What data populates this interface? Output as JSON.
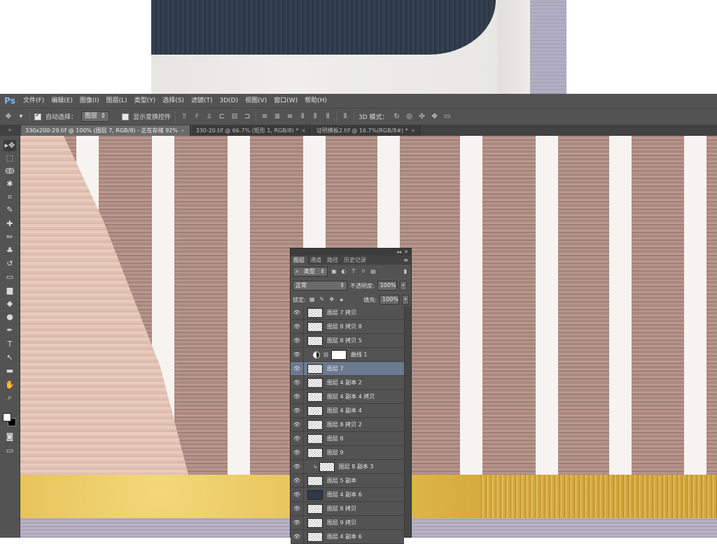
{
  "app": {
    "logo": "Ps"
  },
  "menu": [
    "文件(F)",
    "编辑(E)",
    "图像(I)",
    "图层(L)",
    "类型(Y)",
    "选择(S)",
    "滤镜(T)",
    "3D(D)",
    "视图(V)",
    "窗口(W)",
    "帮助(H)"
  ],
  "options": {
    "move_tool_icon": "move-tool-icon",
    "auto_select_label": "自动选择：",
    "auto_select_value": "图层",
    "show_transform_label": "显示变换控件",
    "mode_label": "3D 模式："
  },
  "tabs": [
    {
      "label": "330x200-29.tif @ 100% (图层 7, RGB/8) - 正在存储 92%",
      "active": true
    },
    {
      "label": "330-20.tif @ 66.7% (矩形 1, RGB/8) *",
      "active": false
    },
    {
      "label": "证明模板2.tif @ 16.7%(RGB/8#) *",
      "active": false
    }
  ],
  "tabs_collapse": "»",
  "tools": [
    "move-icon",
    "marquee-icon",
    "lasso-icon",
    "quick-select-icon",
    "crop-icon",
    "eyedropper-icon",
    "spot-heal-icon",
    "brush-icon",
    "stamp-icon",
    "history-brush-icon",
    "eraser-icon",
    "gradient-icon",
    "blur-icon",
    "dodge-icon",
    "pen-icon",
    "type-icon",
    "path-select-icon",
    "shape-icon",
    "hand-icon",
    "zoom-icon"
  ],
  "tool_glyphs": [
    "▸✥",
    "⬚",
    "ↂ",
    "✱",
    "⌗",
    "✎",
    "✚",
    "✏",
    "♣",
    "↺",
    "▭",
    "▆",
    "◆",
    "●",
    "✒",
    "T",
    "↖",
    "▬",
    "✋",
    "⌕"
  ],
  "layers_panel": {
    "tabs": [
      "图层",
      "通道",
      "路径",
      "历史记录"
    ],
    "filter_label": "类型",
    "blend_mode": "正常",
    "opacity_label": "不透明度:",
    "opacity_value": "100%",
    "lock_label": "锁定:",
    "fill_label": "填充:",
    "fill_value": "100%",
    "layers": [
      {
        "name": "图层 7 拷贝",
        "thumb": "checker"
      },
      {
        "name": "图层 8 拷贝 8",
        "thumb": "checker"
      },
      {
        "name": "图层 8 拷贝 5",
        "thumb": "checker"
      },
      {
        "name": "曲线 1",
        "thumb": "adjust"
      },
      {
        "name": "图层 7",
        "thumb": "checker",
        "selected": true
      },
      {
        "name": "图层 4 副本 2",
        "thumb": "checker"
      },
      {
        "name": "图层 4 副本 4 拷贝",
        "thumb": "checker"
      },
      {
        "name": "图层 4 副本 4",
        "thumb": "checker"
      },
      {
        "name": "图层 8 拷贝 2",
        "thumb": "checker"
      },
      {
        "name": "图层 8",
        "thumb": "checker"
      },
      {
        "name": "图层 9",
        "thumb": "checker"
      },
      {
        "name": "图层 8 副本 3",
        "thumb": "clip"
      },
      {
        "name": "图层 5 副本",
        "thumb": "checker"
      },
      {
        "name": "图层 4 副本 6",
        "thumb": "dark"
      },
      {
        "name": "图层 8 拷贝",
        "thumb": "checker"
      },
      {
        "name": "图层 9 拷贝",
        "thumb": "checker"
      },
      {
        "name": "图层 4 副本 6",
        "thumb": "checker"
      }
    ]
  }
}
